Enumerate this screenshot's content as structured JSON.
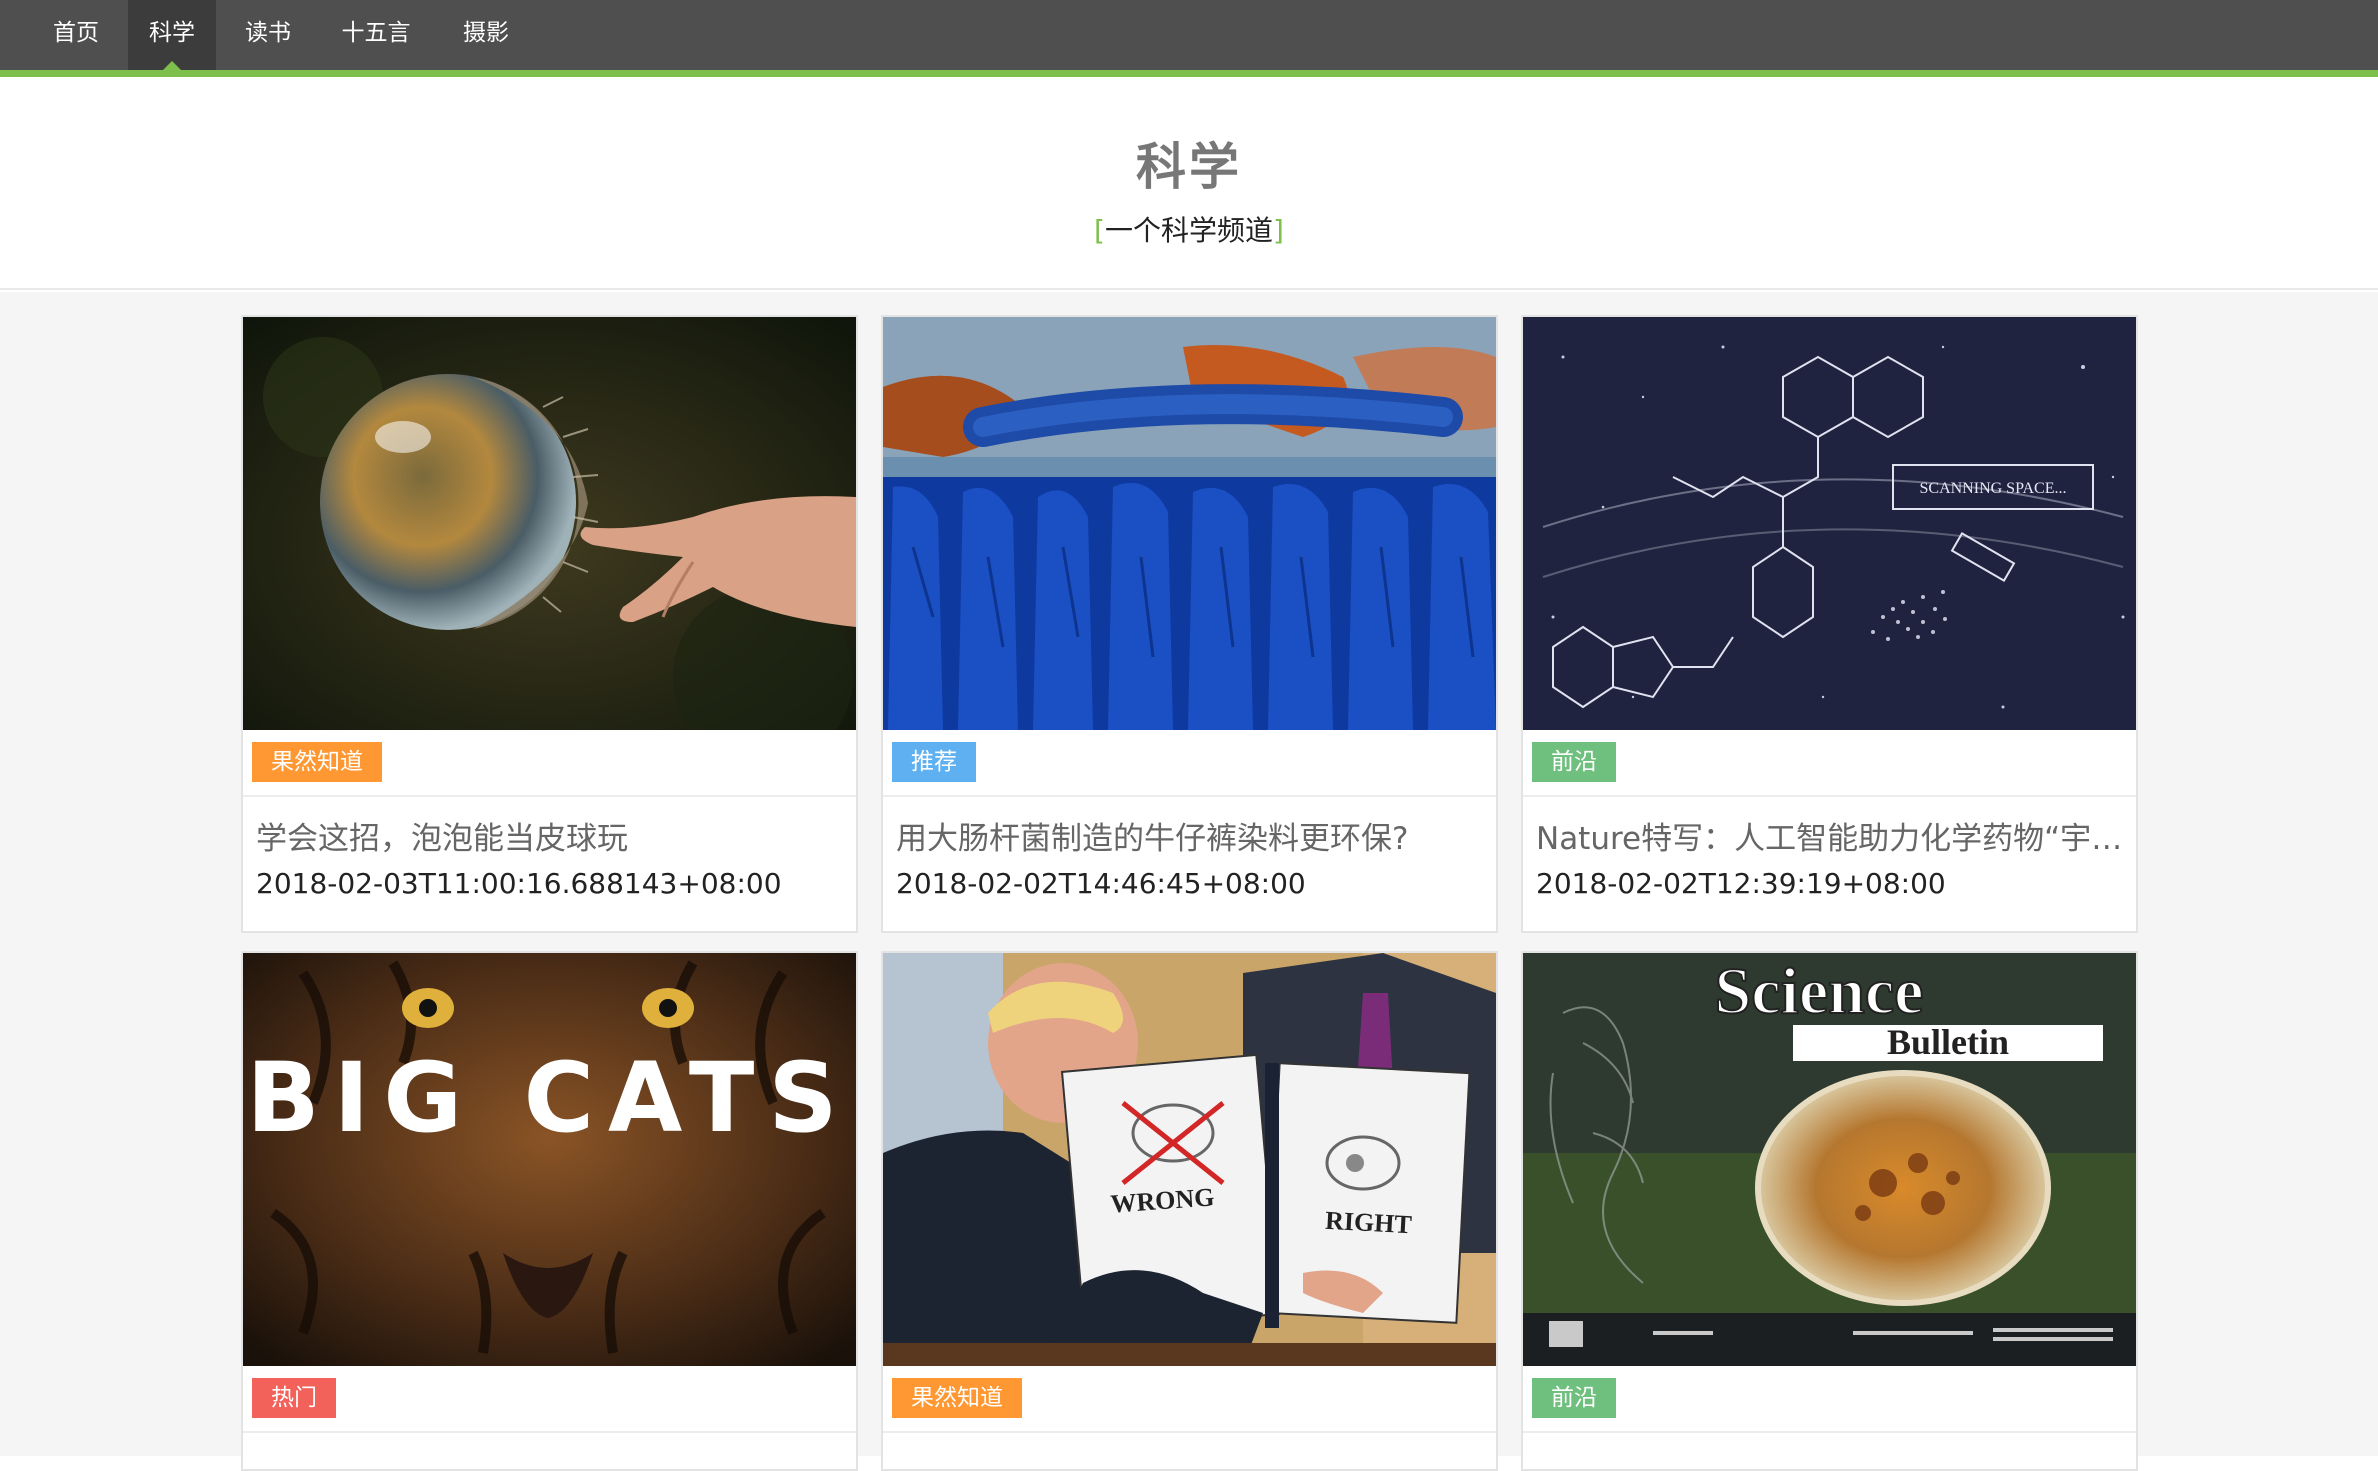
{
  "nav": {
    "items": [
      {
        "label": "首页",
        "active": false
      },
      {
        "label": "科学",
        "active": true
      },
      {
        "label": "读书",
        "active": false
      },
      {
        "label": "十五言",
        "active": false
      },
      {
        "label": "摄影",
        "active": false
      }
    ]
  },
  "channel": {
    "title": "科学",
    "subtitle_open": "[",
    "subtitle": "一个科学频道",
    "subtitle_close": "]"
  },
  "cards": [
    {
      "tag": "果然知道",
      "tag_color": "#ff9833",
      "title": "学会这招，泡泡能当皮球玩",
      "date": "2018-02-03T11:00:16.688143+08:00",
      "image": "bubble-finger-photo"
    },
    {
      "tag": "推荐",
      "tag_color": "#5fb0f0",
      "title": "用大肠杆菌制造的牛仔裤染料更环保?",
      "date": "2018-02-02T14:46:45+08:00",
      "image": "blue-dyed-yarn-photo"
    },
    {
      "tag": "前沿",
      "tag_color": "#6fbf7f",
      "title": "Nature特写：人工智能助力化学药物“宇宙”探索",
      "date": "2018-02-02T12:39:19+08:00",
      "image": "chemical-constellation-illustration"
    },
    {
      "tag": "热门",
      "tag_color": "#f2625a",
      "title": "",
      "date": "",
      "image": "tiger-big-cats-photo",
      "image_text": "BIG CATS"
    },
    {
      "tag": "果然知道",
      "tag_color": "#ff9833",
      "title": "",
      "date": "",
      "image": "wrong-right-sign-photo",
      "image_text_1": "WRONG",
      "image_text_2": "RIGHT"
    },
    {
      "tag": "前沿",
      "tag_color": "#6fbf7f",
      "title": "",
      "date": "",
      "image": "science-bulletin-cover",
      "image_text_1": "Science",
      "image_text_2": "Bulletin"
    }
  ],
  "colors": {
    "nav_bg": "#4f4f4f",
    "nav_active_bg": "#3c3c3c",
    "accent_green": "#7cc04b"
  }
}
